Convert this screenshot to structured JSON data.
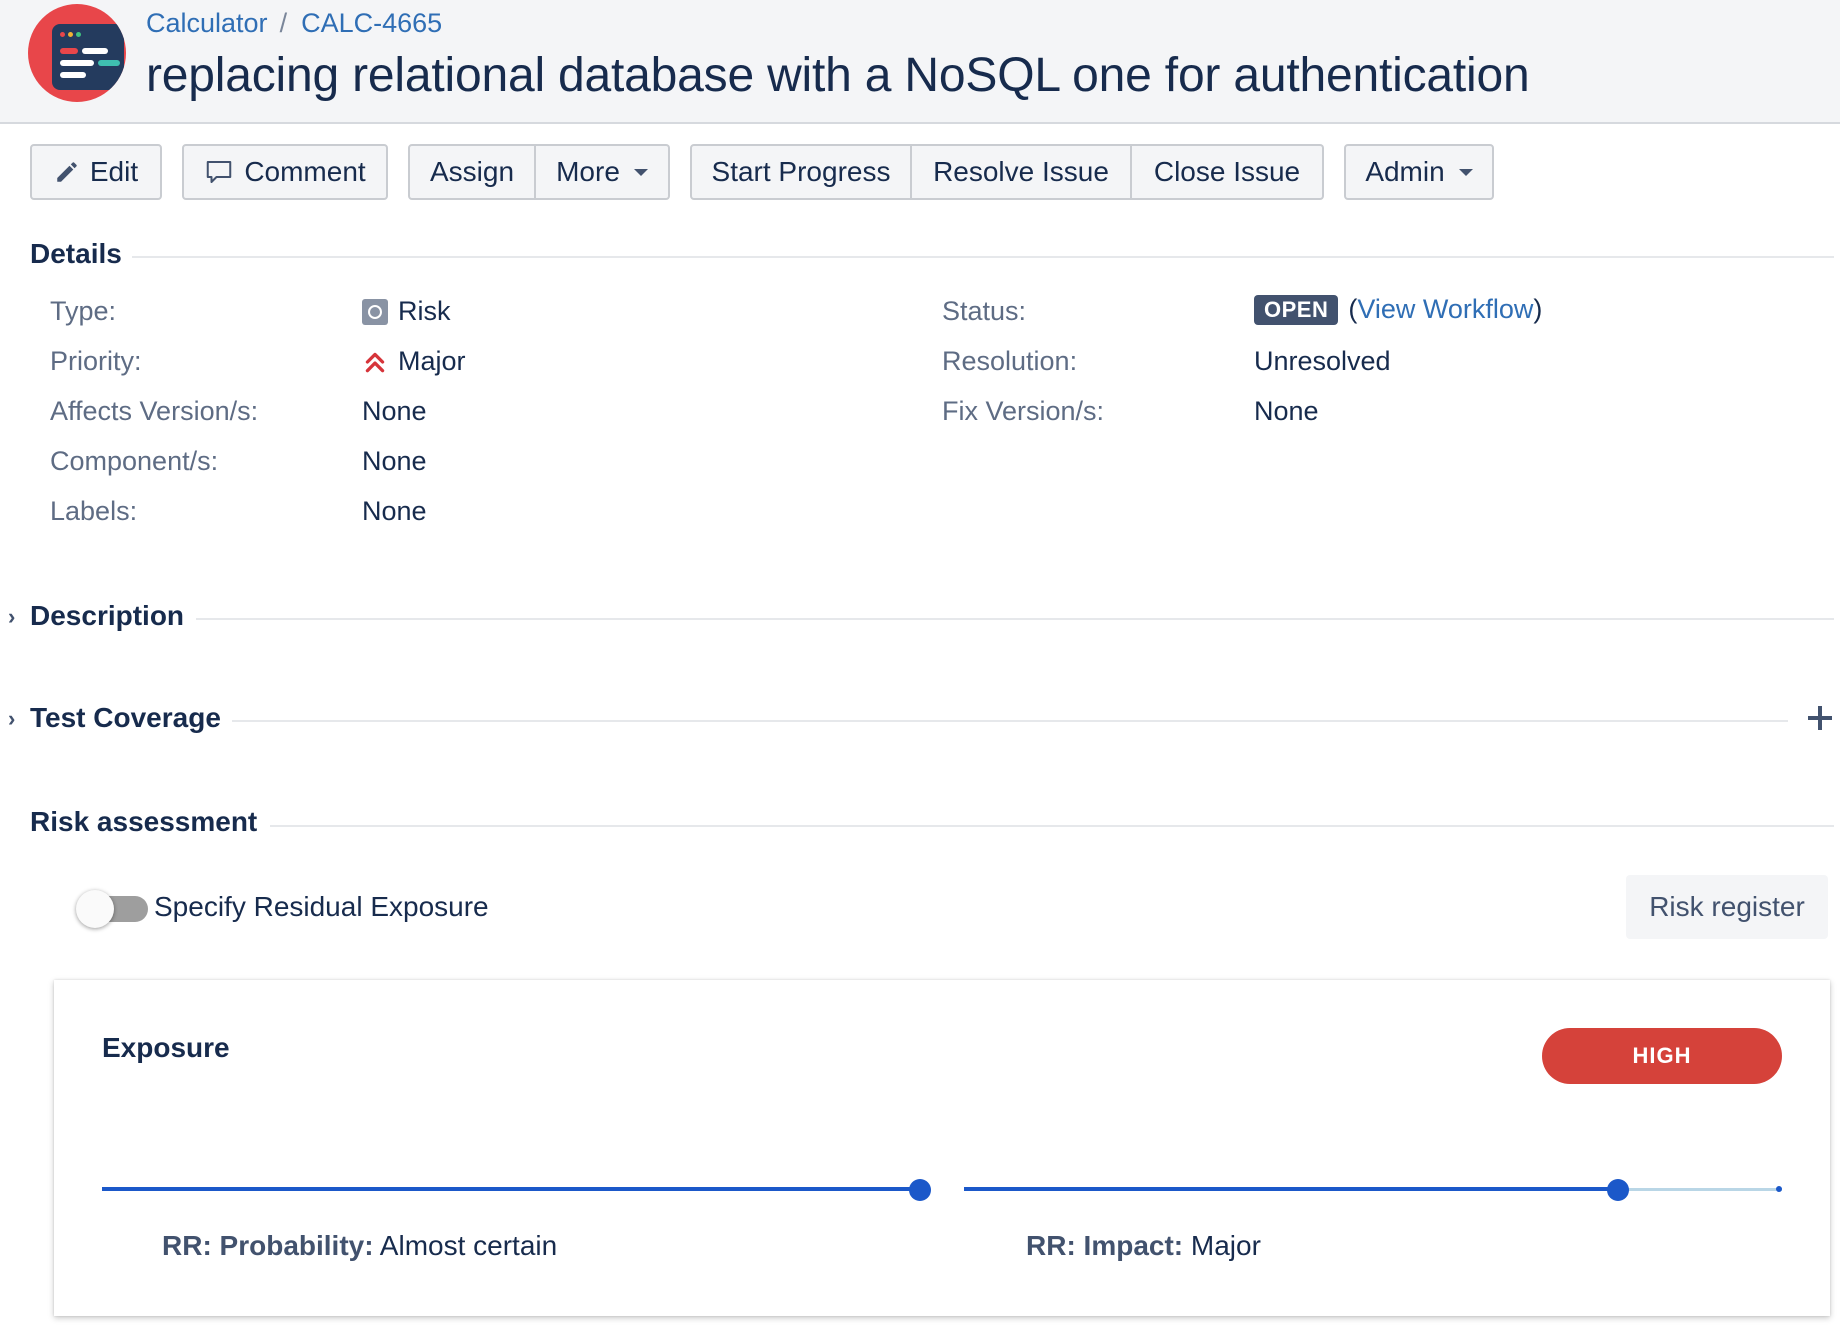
{
  "header": {
    "breadcrumb": {
      "project": "Calculator",
      "separator": "/",
      "issue_key": "CALC-4665"
    },
    "title": "replacing relational database with a NoSQL one for authentication"
  },
  "toolbar": {
    "edit": "Edit",
    "comment": "Comment",
    "assign": "Assign",
    "more": "More",
    "start_progress": "Start Progress",
    "resolve_issue": "Resolve Issue",
    "close_issue": "Close Issue",
    "admin": "Admin"
  },
  "sections": {
    "details": "Details",
    "description": "Description",
    "test_coverage": "Test Coverage",
    "risk_assessment": "Risk assessment"
  },
  "details": {
    "type_label": "Type:",
    "type_value": "Risk",
    "priority_label": "Priority:",
    "priority_value": "Major",
    "affects_label": "Affects Version/s:",
    "affects_value": "None",
    "components_label": "Component/s:",
    "components_value": "None",
    "labels_label": "Labels:",
    "labels_value": "None",
    "status_label": "Status:",
    "status_value": "OPEN",
    "status_paren_open": "(",
    "view_workflow": "View Workflow",
    "status_paren_close": ")",
    "resolution_label": "Resolution:",
    "resolution_value": "Unresolved",
    "fix_label": "Fix Version/s:",
    "fix_value": "None"
  },
  "risk": {
    "toggle_label": "Specify Residual Exposure",
    "toggle_on": false,
    "risk_register": "Risk register",
    "exposure_title": "Exposure",
    "exposure_level": "HIGH",
    "probability_label": "RR: Probability:",
    "probability_value": "Almost certain",
    "probability_fraction": 1.0,
    "impact_label": "RR: Impact:",
    "impact_value": "Major",
    "impact_fraction": 0.8
  },
  "colors": {
    "accent": "#2f6eb5",
    "high": "#d5423a",
    "slider": "#1b58c9",
    "priority": "#d6343a"
  }
}
